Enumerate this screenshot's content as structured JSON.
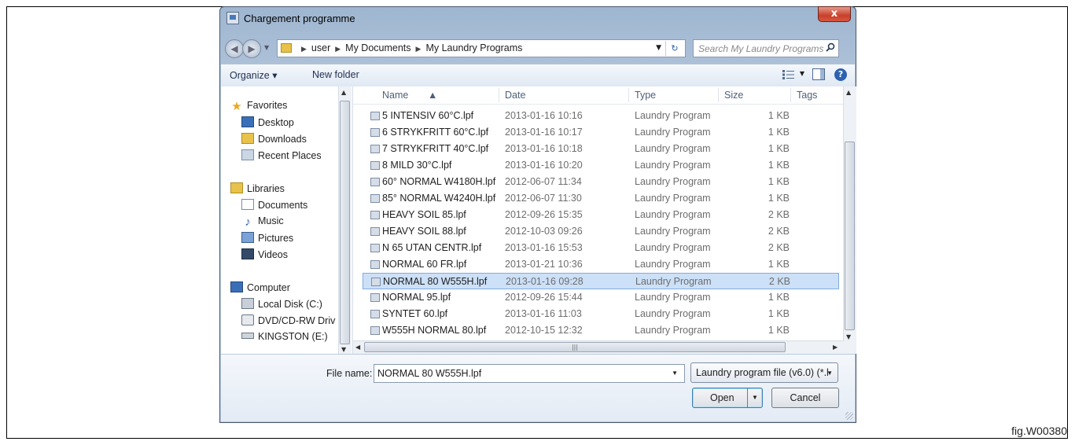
{
  "window": {
    "title": "Chargement programme",
    "close_symbol": "x"
  },
  "address": {
    "crumbs": [
      "user",
      "My Documents",
      "My Laundry Programs"
    ],
    "search_placeholder": "Search My Laundry Programs"
  },
  "toolbar": {
    "organize_label": "Organize ▾",
    "new_folder_label": "New folder",
    "help_symbol": "?"
  },
  "nav": {
    "favorites": "Favorites",
    "desktop": "Desktop",
    "downloads": "Downloads",
    "recent": "Recent Places",
    "libraries": "Libraries",
    "documents": "Documents",
    "music": "Music",
    "pictures": "Pictures",
    "videos": "Videos",
    "computer": "Computer",
    "local_disk": "Local Disk (C:)",
    "dvd": "DVD/CD-RW Driv",
    "kingston": "KINGSTON (E:)"
  },
  "columns": {
    "name": "Name",
    "date": "Date",
    "type": "Type",
    "size": "Size",
    "tags": "Tags"
  },
  "files": [
    {
      "name": "5 INTENSIV 60°C.lpf",
      "date": "2013-01-16 10:16",
      "type": "Laundry Program",
      "size": "1 KB"
    },
    {
      "name": "6 STRYKFRITT 60°C.lpf",
      "date": "2013-01-16 10:17",
      "type": "Laundry Program",
      "size": "1 KB"
    },
    {
      "name": "7 STRYKFRITT 40°C.lpf",
      "date": "2013-01-16 10:18",
      "type": "Laundry Program",
      "size": "1 KB"
    },
    {
      "name": "8 MILD 30°C.lpf",
      "date": "2013-01-16 10:20",
      "type": "Laundry Program",
      "size": "1 KB"
    },
    {
      "name": "60° NORMAL W4180H.lpf",
      "date": "2012-06-07 11:34",
      "type": "Laundry Program",
      "size": "1 KB"
    },
    {
      "name": "85° NORMAL W4240H.lpf",
      "date": "2012-06-07 11:30",
      "type": "Laundry Program",
      "size": "1 KB"
    },
    {
      "name": "HEAVY SOIL 85.lpf",
      "date": "2012-09-26 15:35",
      "type": "Laundry Program",
      "size": "2 KB"
    },
    {
      "name": "HEAVY SOIL 88.lpf",
      "date": "2012-10-03 09:26",
      "type": "Laundry Program",
      "size": "2 KB"
    },
    {
      "name": "N 65 UTAN CENTR.lpf",
      "date": "2013-01-16 15:53",
      "type": "Laundry Program",
      "size": "2 KB"
    },
    {
      "name": "NORMAL 60 FR.lpf",
      "date": "2013-01-21 10:36",
      "type": "Laundry Program",
      "size": "1 KB"
    },
    {
      "name": "NORMAL 80 W555H.lpf",
      "date": "2013-01-16 09:28",
      "type": "Laundry Program",
      "size": "2 KB"
    },
    {
      "name": "NORMAL 95.lpf",
      "date": "2012-09-26 15:44",
      "type": "Laundry Program",
      "size": "1 KB"
    },
    {
      "name": "SYNTET 60.lpf",
      "date": "2013-01-16 11:03",
      "type": "Laundry Program",
      "size": "1 KB"
    },
    {
      "name": "W555H NORMAL 80.lpf",
      "date": "2012-10-15 12:32",
      "type": "Laundry Program",
      "size": "1 KB"
    }
  ],
  "selected_index": 10,
  "bottom": {
    "file_name_label": "File name:",
    "file_name_value": "NORMAL 80 W555H.lpf",
    "filter": "Laundry program file (v6.0) (*.l",
    "open_label": "Open",
    "cancel_label": "Cancel"
  },
  "figure_label": "fig.W00380",
  "colors": {
    "selection": "#cce0f7",
    "accent": "#2d62b0"
  }
}
